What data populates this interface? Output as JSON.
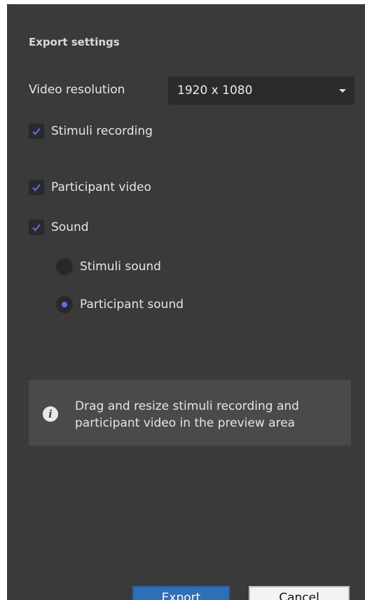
{
  "export_settings": {
    "title": "Export settings",
    "video_resolution": {
      "label": "Video resolution",
      "selected": "1920 x 1080"
    },
    "checkboxes": [
      {
        "label": "Stimuli recording",
        "checked": true
      },
      {
        "label": "Participant video",
        "checked": true
      },
      {
        "label": "Sound",
        "checked": true
      }
    ],
    "sound_options": [
      {
        "label": "Stimuli sound",
        "selected": false
      },
      {
        "label": "Participant sound",
        "selected": true
      }
    ],
    "info": {
      "icon": "info-icon",
      "text": "Drag and resize stimuli recording and participant video in the preview area"
    }
  },
  "buttons": {
    "export_label": "Export",
    "cancel_label": "Cancel"
  },
  "colors": {
    "panel_bg": "#3a3a3a",
    "accent": "#5b6ef5",
    "export_button": "#2f6fb6"
  }
}
